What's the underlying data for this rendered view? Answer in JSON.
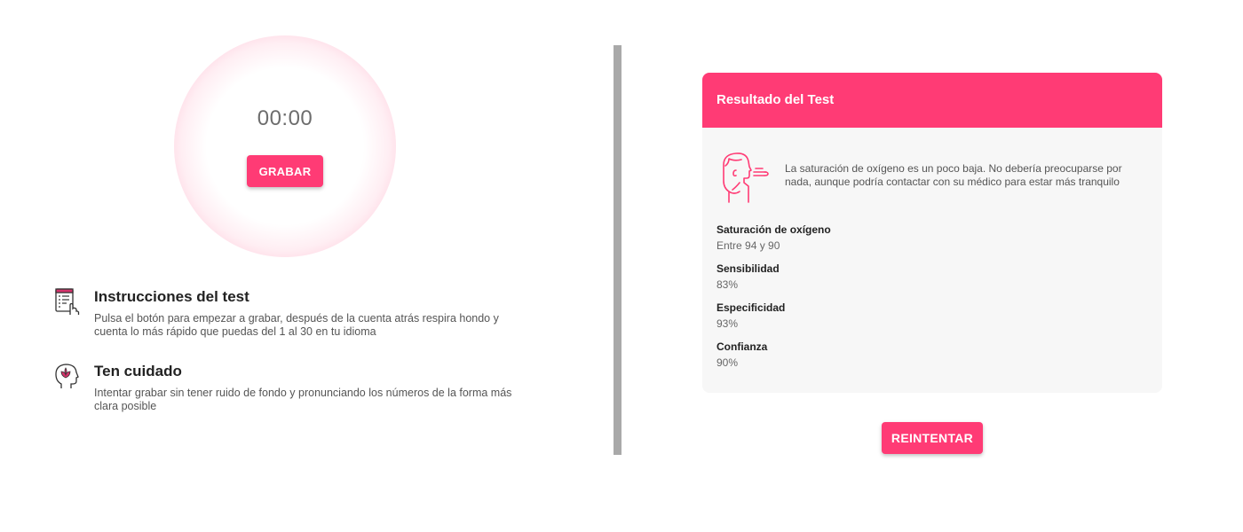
{
  "recorder": {
    "timer": "00:00",
    "record_label": "GRABAR"
  },
  "instructions": {
    "title": "Instrucciones del test",
    "text": "Pulsa el botón para empezar a grabar, después de la cuenta atrás respira hondo y cuenta lo más rápido que puedas del 1 al 30 en tu idioma",
    "icon": "instructions-document-hand-icon"
  },
  "caution": {
    "title": "Ten cuidado",
    "text": "Intentar grabar sin tener ruido de fondo y pronunciando los números de la forma más clara posible",
    "icon": "head-lotus-icon"
  },
  "result": {
    "title": "Resultado del Test",
    "icon": "person-breathing-icon",
    "message": "La saturación de oxígeno es un poco baja. No debería preocuparse por nada, aunque podría contactar con su médico para estar más tranquilo",
    "metrics": [
      {
        "label": "Saturación de oxígeno",
        "value": "Entre 94 y 90"
      },
      {
        "label": "Sensibilidad",
        "value": "83%"
      },
      {
        "label": "Especificidad",
        "value": "93%"
      },
      {
        "label": "Confianza",
        "value": "90%"
      }
    ]
  },
  "retry_label": "REINTENTAR",
  "colors": {
    "accent": "#ff3b75",
    "divider": "#a9a9a9",
    "card_bg": "#f7f7f7"
  }
}
